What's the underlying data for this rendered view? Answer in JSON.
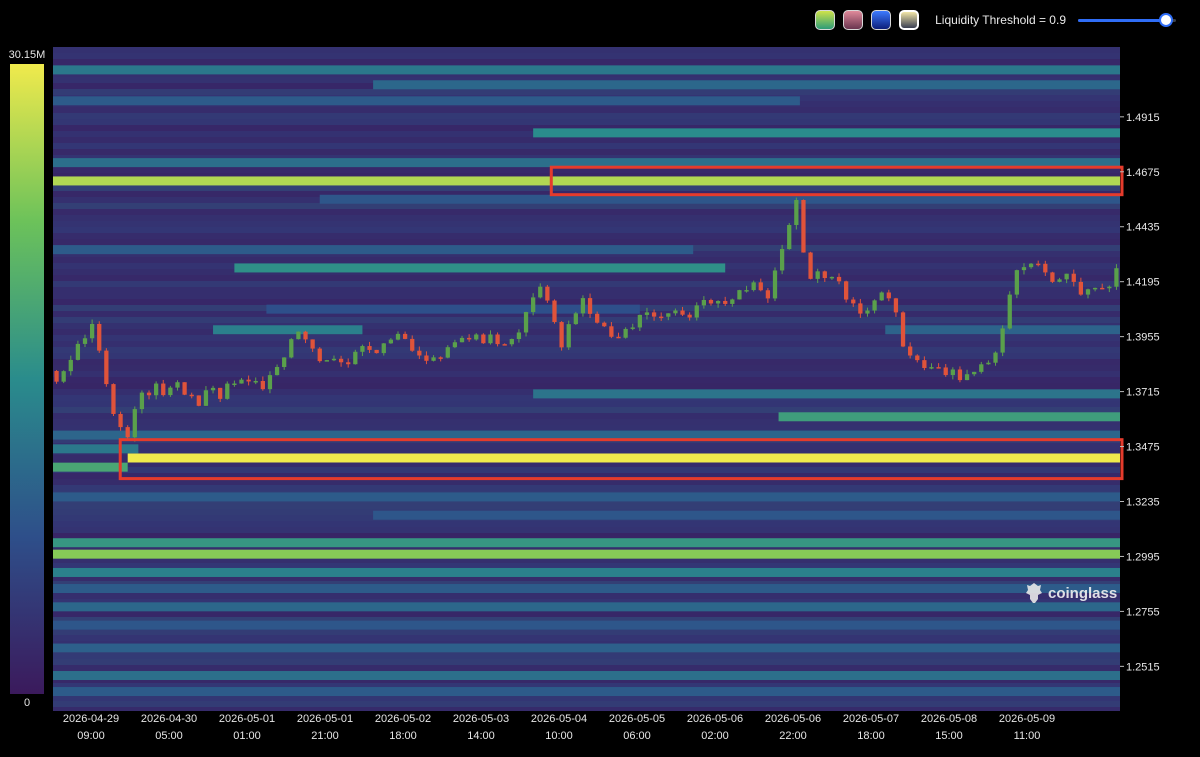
{
  "toolbar": {
    "swatches": [
      {
        "name": "viridis",
        "colors": [
          "#2e9c78",
          "#cfe34a"
        ]
      },
      {
        "name": "rose",
        "colors": [
          "#6a3550",
          "#e08a9a"
        ]
      },
      {
        "name": "blue",
        "colors": [
          "#0c1e7a",
          "#3d7bff"
        ]
      },
      {
        "name": "gold",
        "colors": [
          "#3a3f52",
          "#f2e6a8"
        ]
      }
    ],
    "active_swatch": 3,
    "threshold_label": "Liquidity Threshold = 0.9",
    "threshold_value": 0.9,
    "slider_accent": "#2f6df6"
  },
  "watermark": {
    "text": "coinglass"
  },
  "colors": {
    "background": "#000000",
    "heatmap_low": "#3b1a5c",
    "heatmap_high": "#f0ea4c",
    "candle_up": "#5aa04b",
    "candle_down": "#e0533a",
    "highlight_box": "#e53b2c"
  },
  "chart_data": {
    "type": "heatmap",
    "title": "",
    "colorbar": {
      "max_label": "30.15M",
      "min_label": "0",
      "max": 30150000,
      "min": 0
    },
    "x_ticks": [
      [
        "2026-04-29",
        "09:00"
      ],
      [
        "2026-04-30",
        "05:00"
      ],
      [
        "2026-05-01",
        "01:00"
      ],
      [
        "2026-05-01",
        "21:00"
      ],
      [
        "2026-05-02",
        "18:00"
      ],
      [
        "2026-05-03",
        "14:00"
      ],
      [
        "2026-05-04",
        "10:00"
      ],
      [
        "2026-05-05",
        "06:00"
      ],
      [
        "2026-05-06",
        "02:00"
      ],
      [
        "2026-05-06",
        "22:00"
      ],
      [
        "2026-05-07",
        "18:00"
      ],
      [
        "2026-05-08",
        "15:00"
      ],
      [
        "2026-05-09",
        "11:00"
      ]
    ],
    "y_ticks": [
      "1.4915",
      "1.4675",
      "1.4435",
      "1.4195",
      "1.3955",
      "1.3715",
      "1.3475",
      "1.3235",
      "1.2995",
      "1.2755",
      "1.2515"
    ],
    "ylim": [
      1.232,
      1.522
    ],
    "xlim": [
      0,
      1
    ],
    "liquidity_bands": [
      {
        "price": 1.512,
        "intensity": 0.42,
        "start": 0.0,
        "end": 1.0
      },
      {
        "price": 1.5055,
        "intensity": 0.35,
        "start": 0.3,
        "end": 1.0
      },
      {
        "price": 1.4985,
        "intensity": 0.3,
        "start": 0.0,
        "end": 0.7
      },
      {
        "price": 1.4845,
        "intensity": 0.5,
        "start": 0.45,
        "end": 1.0
      },
      {
        "price": 1.4715,
        "intensity": 0.38,
        "start": 0.0,
        "end": 1.0
      },
      {
        "price": 1.4635,
        "intensity": 0.88,
        "start": 0.0,
        "end": 1.0
      },
      {
        "price": 1.4555,
        "intensity": 0.28,
        "start": 0.25,
        "end": 1.0
      },
      {
        "price": 1.4335,
        "intensity": 0.3,
        "start": 0.0,
        "end": 0.6
      },
      {
        "price": 1.4255,
        "intensity": 0.52,
        "start": 0.17,
        "end": 0.63
      },
      {
        "price": 1.4075,
        "intensity": 0.25,
        "start": 0.2,
        "end": 0.55
      },
      {
        "price": 1.3985,
        "intensity": 0.45,
        "start": 0.15,
        "end": 0.29
      },
      {
        "price": 1.3985,
        "intensity": 0.33,
        "start": 0.78,
        "end": 1.0
      },
      {
        "price": 1.3705,
        "intensity": 0.4,
        "start": 0.45,
        "end": 1.0
      },
      {
        "price": 1.3605,
        "intensity": 0.58,
        "start": 0.68,
        "end": 1.0
      },
      {
        "price": 1.3525,
        "intensity": 0.34,
        "start": 0.0,
        "end": 1.0
      },
      {
        "price": 1.3465,
        "intensity": 0.42,
        "start": 0.0,
        "end": 0.08
      },
      {
        "price": 1.3425,
        "intensity": 1.0,
        "start": 0.07,
        "end": 1.0
      },
      {
        "price": 1.3385,
        "intensity": 0.62,
        "start": 0.0,
        "end": 0.07
      },
      {
        "price": 1.3255,
        "intensity": 0.3,
        "start": 0.0,
        "end": 1.0
      },
      {
        "price": 1.3175,
        "intensity": 0.28,
        "start": 0.3,
        "end": 1.0
      },
      {
        "price": 1.3055,
        "intensity": 0.55,
        "start": 0.0,
        "end": 1.0
      },
      {
        "price": 1.3005,
        "intensity": 0.8,
        "start": 0.0,
        "end": 1.0
      },
      {
        "price": 1.2925,
        "intensity": 0.45,
        "start": 0.0,
        "end": 1.0
      },
      {
        "price": 1.2855,
        "intensity": 0.3,
        "start": 0.0,
        "end": 1.0
      },
      {
        "price": 1.2775,
        "intensity": 0.35,
        "start": 0.0,
        "end": 1.0
      },
      {
        "price": 1.2695,
        "intensity": 0.28,
        "start": 0.0,
        "end": 1.0
      },
      {
        "price": 1.2595,
        "intensity": 0.32,
        "start": 0.0,
        "end": 1.0
      },
      {
        "price": 1.2475,
        "intensity": 0.38,
        "start": 0.0,
        "end": 1.0
      },
      {
        "price": 1.2405,
        "intensity": 0.3,
        "start": 0.0,
        "end": 1.0
      }
    ],
    "highlight_zones": [
      {
        "x0": 0.467,
        "x1": 1.0,
        "y0": 1.4575,
        "y1": 1.4695
      },
      {
        "x0": 0.063,
        "x1": 1.0,
        "y0": 1.3335,
        "y1": 1.3505
      }
    ],
    "price_path": [
      [
        0.0,
        1.3805
      ],
      [
        0.01,
        1.378
      ],
      [
        0.02,
        1.3875
      ],
      [
        0.03,
        1.392
      ],
      [
        0.04,
        1.4005
      ],
      [
        0.05,
        1.387
      ],
      [
        0.058,
        1.364
      ],
      [
        0.066,
        1.354
      ],
      [
        0.072,
        1.347
      ],
      [
        0.08,
        1.366
      ],
      [
        0.09,
        1.37
      ],
      [
        0.1,
        1.377
      ],
      [
        0.11,
        1.369
      ],
      [
        0.12,
        1.376
      ],
      [
        0.13,
        1.371
      ],
      [
        0.14,
        1.364
      ],
      [
        0.15,
        1.372
      ],
      [
        0.16,
        1.37
      ],
      [
        0.17,
        1.3745
      ],
      [
        0.18,
        1.378
      ],
      [
        0.19,
        1.376
      ],
      [
        0.2,
        1.3745
      ],
      [
        0.21,
        1.379
      ],
      [
        0.22,
        1.388
      ],
      [
        0.228,
        1.3975
      ],
      [
        0.24,
        1.393
      ],
      [
        0.25,
        1.388
      ],
      [
        0.26,
        1.383
      ],
      [
        0.27,
        1.386
      ],
      [
        0.28,
        1.385
      ],
      [
        0.29,
        1.388
      ],
      [
        0.3,
        1.39
      ],
      [
        0.31,
        1.3905
      ],
      [
        0.32,
        1.392
      ],
      [
        0.33,
        1.395
      ],
      [
        0.34,
        1.39
      ],
      [
        0.35,
        1.385
      ],
      [
        0.36,
        1.387
      ],
      [
        0.37,
        1.389
      ],
      [
        0.38,
        1.391
      ],
      [
        0.39,
        1.3955
      ],
      [
        0.4,
        1.397
      ],
      [
        0.41,
        1.3945
      ],
      [
        0.42,
        1.395
      ],
      [
        0.43,
        1.39
      ],
      [
        0.44,
        1.398
      ],
      [
        0.445,
        1.404
      ],
      [
        0.45,
        1.414
      ],
      [
        0.46,
        1.417
      ],
      [
        0.47,
        1.408
      ],
      [
        0.478,
        1.39
      ],
      [
        0.49,
        1.406
      ],
      [
        0.5,
        1.413
      ],
      [
        0.51,
        1.402
      ],
      [
        0.52,
        1.399
      ],
      [
        0.53,
        1.395
      ],
      [
        0.54,
        1.398
      ],
      [
        0.55,
        1.401
      ],
      [
        0.56,
        1.404
      ],
      [
        0.57,
        1.406
      ],
      [
        0.58,
        1.405
      ],
      [
        0.59,
        1.408
      ],
      [
        0.6,
        1.403
      ],
      [
        0.61,
        1.409
      ],
      [
        0.62,
        1.411
      ],
      [
        0.63,
        1.408
      ],
      [
        0.64,
        1.412
      ],
      [
        0.65,
        1.415
      ],
      [
        0.66,
        1.418
      ],
      [
        0.67,
        1.411
      ],
      [
        0.68,
        1.422
      ],
      [
        0.69,
        1.438
      ],
      [
        0.697,
        1.453
      ],
      [
        0.702,
        1.455
      ],
      [
        0.71,
        1.42
      ],
      [
        0.72,
        1.423
      ],
      [
        0.73,
        1.421
      ],
      [
        0.74,
        1.418
      ],
      [
        0.75,
        1.41
      ],
      [
        0.76,
        1.404
      ],
      [
        0.77,
        1.408
      ],
      [
        0.78,
        1.412
      ],
      [
        0.79,
        1.408
      ],
      [
        0.8,
        1.394
      ],
      [
        0.81,
        1.384
      ],
      [
        0.82,
        1.38
      ],
      [
        0.83,
        1.383
      ],
      [
        0.84,
        1.381
      ],
      [
        0.85,
        1.379
      ],
      [
        0.86,
        1.379
      ],
      [
        0.87,
        1.383
      ],
      [
        0.88,
        1.387
      ],
      [
        0.89,
        1.392
      ],
      [
        0.897,
        1.405
      ],
      [
        0.905,
        1.421
      ],
      [
        0.915,
        1.43
      ],
      [
        0.925,
        1.427
      ],
      [
        0.935,
        1.423
      ],
      [
        0.945,
        1.42
      ],
      [
        0.955,
        1.421
      ],
      [
        0.965,
        1.415
      ],
      [
        0.975,
        1.42
      ],
      [
        0.985,
        1.418
      ],
      [
        0.995,
        1.42
      ],
      [
        1.0,
        1.425
      ]
    ]
  }
}
